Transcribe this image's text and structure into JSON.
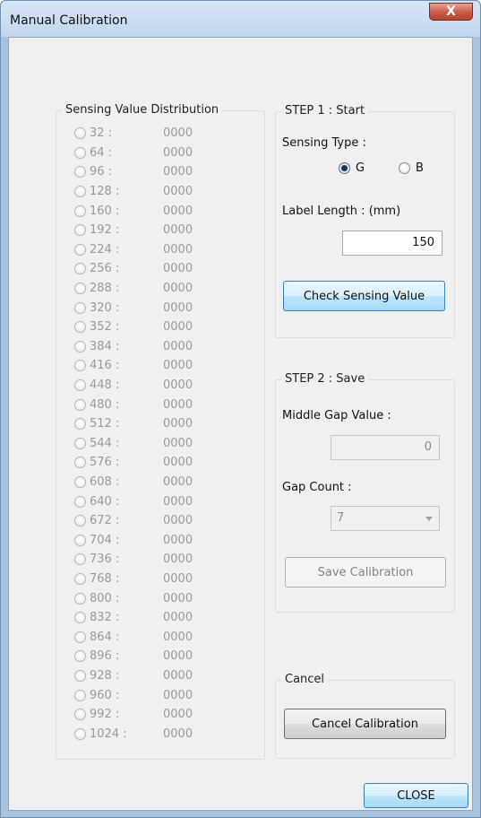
{
  "window": {
    "title": "Manual Calibration",
    "close_glyph": "X"
  },
  "distribution": {
    "title": "Sensing Value Distribution",
    "rows": [
      {
        "key": "32 :",
        "value": "0000"
      },
      {
        "key": "64 :",
        "value": "0000"
      },
      {
        "key": "96 :",
        "value": "0000"
      },
      {
        "key": "128 :",
        "value": "0000"
      },
      {
        "key": "160 :",
        "value": "0000"
      },
      {
        "key": "192 :",
        "value": "0000"
      },
      {
        "key": "224 :",
        "value": "0000"
      },
      {
        "key": "256 :",
        "value": "0000"
      },
      {
        "key": "288 :",
        "value": "0000"
      },
      {
        "key": "320 :",
        "value": "0000"
      },
      {
        "key": "352 :",
        "value": "0000"
      },
      {
        "key": "384 :",
        "value": "0000"
      },
      {
        "key": "416 :",
        "value": "0000"
      },
      {
        "key": "448 :",
        "value": "0000"
      },
      {
        "key": "480 :",
        "value": "0000"
      },
      {
        "key": "512 :",
        "value": "0000"
      },
      {
        "key": "544 :",
        "value": "0000"
      },
      {
        "key": "576 :",
        "value": "0000"
      },
      {
        "key": "608 :",
        "value": "0000"
      },
      {
        "key": "640 :",
        "value": "0000"
      },
      {
        "key": "672 :",
        "value": "0000"
      },
      {
        "key": "704 :",
        "value": "0000"
      },
      {
        "key": "736 :",
        "value": "0000"
      },
      {
        "key": "768 :",
        "value": "0000"
      },
      {
        "key": "800 :",
        "value": "0000"
      },
      {
        "key": "832 :",
        "value": "0000"
      },
      {
        "key": "864 :",
        "value": "0000"
      },
      {
        "key": "896 :",
        "value": "0000"
      },
      {
        "key": "928 :",
        "value": "0000"
      },
      {
        "key": "960 :",
        "value": "0000"
      },
      {
        "key": "992 :",
        "value": "0000"
      },
      {
        "key": "1024 :",
        "value": "0000"
      }
    ]
  },
  "step1": {
    "title": "STEP 1 : Start",
    "sensing_type_label": "Sensing Type :",
    "option_g": "G",
    "option_b": "B",
    "selected": "G",
    "label_length_label": "Label Length : (mm)",
    "label_length_value": "150",
    "check_button": "Check Sensing Value"
  },
  "step2": {
    "title": "STEP 2 : Save",
    "middle_gap_label": "Middle Gap Value :",
    "middle_gap_value": "0",
    "gap_count_label": "Gap Count :",
    "gap_count_value": "7",
    "save_button": "Save Calibration"
  },
  "cancel": {
    "title": "Cancel",
    "cancel_button": "Cancel Calibration"
  },
  "footer": {
    "close_button": "CLOSE"
  }
}
